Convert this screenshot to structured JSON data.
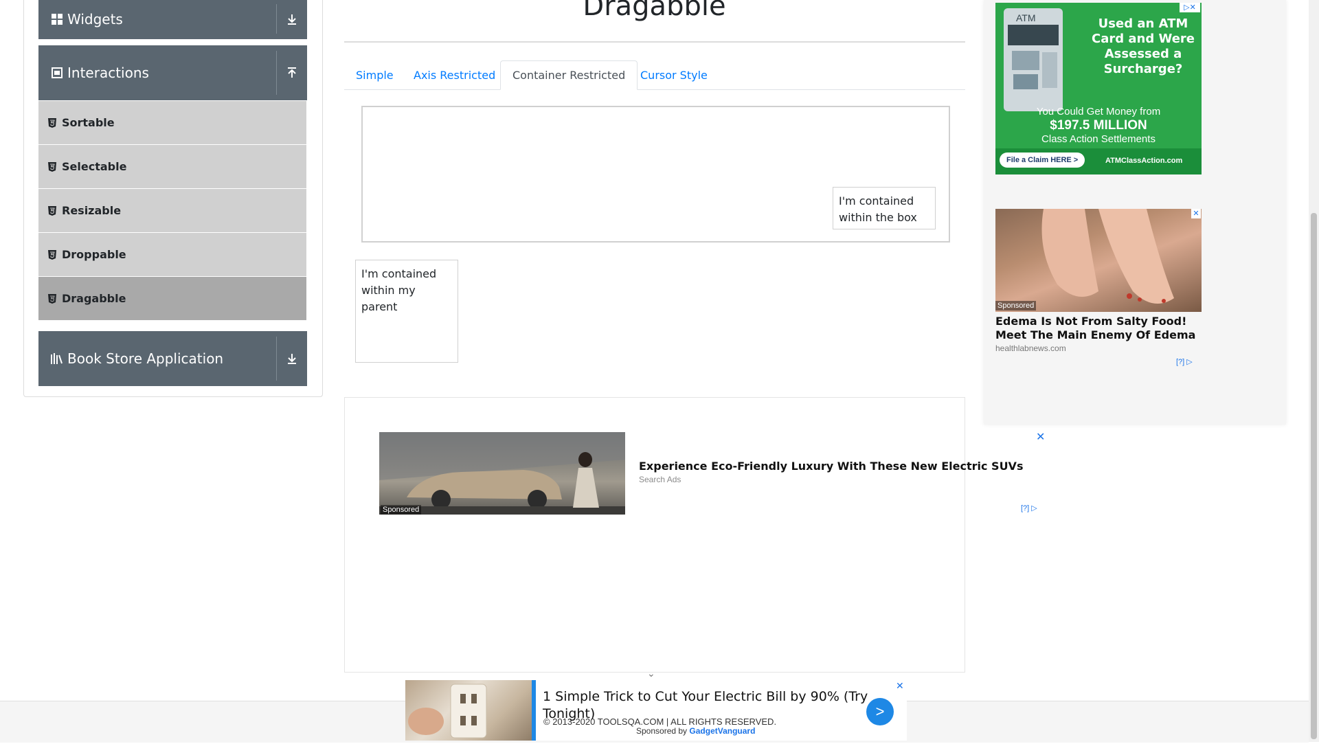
{
  "sidebar": {
    "widgets_label": "Widgets",
    "interactions_label": "Interactions",
    "items": [
      {
        "label": "Sortable"
      },
      {
        "label": "Selectable"
      },
      {
        "label": "Resizable"
      },
      {
        "label": "Droppable"
      },
      {
        "label": "Dragabble"
      }
    ],
    "book_store_label": "Book Store Application"
  },
  "main": {
    "title": "Dragabble",
    "tabs": [
      {
        "label": "Simple"
      },
      {
        "label": "Axis Restricted"
      },
      {
        "label": "Container Restricted"
      },
      {
        "label": "Cursor Style"
      }
    ],
    "active_tab": "Container Restricted",
    "box_item_text": "I'm contained within the box",
    "parent_item_text": "I'm contained within my parent"
  },
  "ads": {
    "atm": {
      "atm_label": "ATM",
      "headline": "Used an ATM Card and Were Assessed a Surcharge?",
      "line1": "You Could Get Money from",
      "amount": "$197.5 MILLION",
      "line2": "Class Action Settlements",
      "cta": "File a Claim HERE >",
      "domain": "ATMClassAction.com"
    },
    "edema": {
      "sponsored": "Sponsored",
      "headline": "Edema Is Not From Salty Food! Meet The Main Enemy Of Edema",
      "domain": "healthlabnews.com",
      "help": "[?]"
    },
    "suv": {
      "sponsored": "Sponsored",
      "headline": "Experience Eco-Friendly Luxury With These New Electric SUVs",
      "source": "Search Ads",
      "help": "[?]"
    },
    "bottom": {
      "headline": "1 Simple Trick to Cut Your Electric Bill by 90% (Try Tonight)",
      "arrow": ">"
    }
  },
  "footer": {
    "copyright": "© 2013-2020 TOOLSQA.COM | ALL RIGHTS RESERVED.",
    "sponsored_by": "Sponsored by",
    "sponsor": "GadgetVanguard"
  },
  "colors": {
    "link": "#007bff",
    "sidebar_header": "#5a6670",
    "menu_item": "#d0d0d0",
    "menu_item_active": "#a9a9a9",
    "atm_green": "#2ca64a"
  }
}
